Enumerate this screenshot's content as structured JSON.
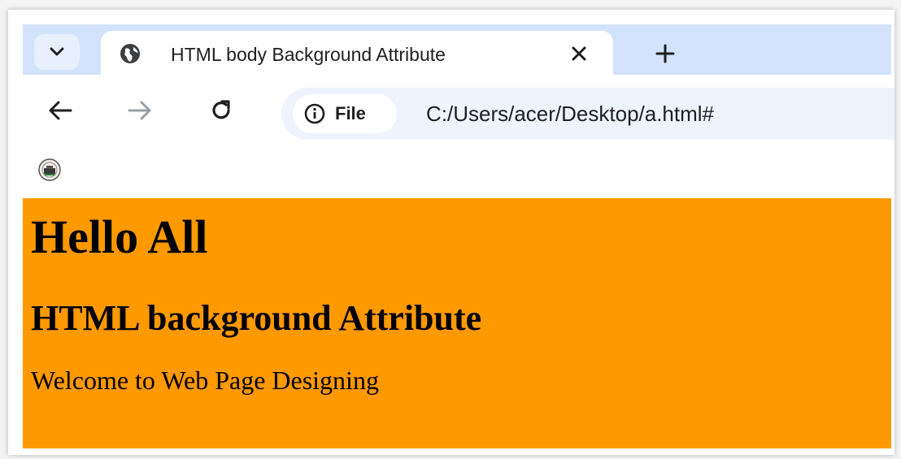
{
  "browser": {
    "tab": {
      "title": "HTML body Background Attribute",
      "icon": "globe-icon"
    },
    "tab_search_icon": "chevron-down-icon",
    "new_tab_icon": "plus-icon",
    "close_icon": "close-icon",
    "nav": {
      "back_icon": "arrow-left-icon",
      "forward_icon": "arrow-right-icon",
      "reload_icon": "reload-icon"
    },
    "omnibox": {
      "chip_icon": "info-icon",
      "chip_label": "File",
      "url": "C:/Users/acer/Desktop/a.html#"
    },
    "bookmark_icon": "emblem-icon"
  },
  "page": {
    "background_color": "#ff9900",
    "heading1": "Hello All",
    "heading2": "HTML background Attribute",
    "paragraph": "Welcome to Web Page Designing"
  }
}
